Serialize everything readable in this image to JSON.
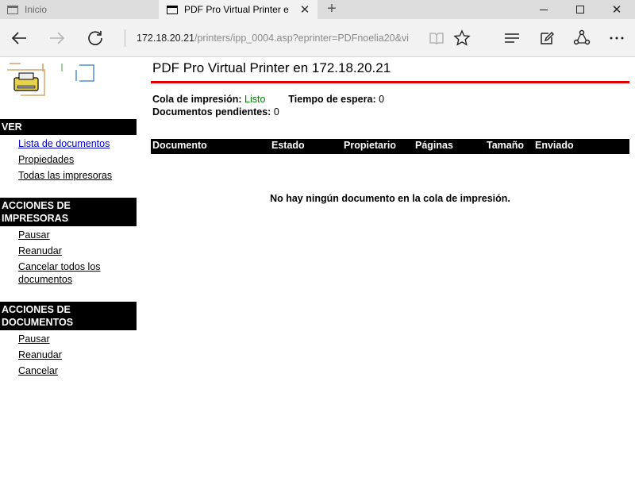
{
  "browser": {
    "tabs": [
      {
        "title": "Inicio"
      },
      {
        "title": "PDF Pro Virtual Printer e"
      }
    ],
    "url_host": "172.18.20.21",
    "url_rest": "/printers/ipp_0004.asp?eprinter=PDFnoelia20&vi"
  },
  "page": {
    "title": "PDF Pro Virtual Printer en 172.18.20.21",
    "queue_label": "Cola de impresión:",
    "queue_value": "Listo",
    "wait_label": "Tiempo de espera:",
    "wait_value": "0",
    "pending_label": "Documentos pendientes:",
    "pending_value": "0",
    "columns": [
      "Documento",
      "Estado",
      "Propietario",
      "Páginas",
      "Tamaño",
      "Enviado"
    ],
    "empty_message": "No hay ningún documento en la cola de impresión."
  },
  "sidebar": {
    "sections": [
      {
        "heading": "VER",
        "links": [
          "Lista de documentos",
          "Propiedades",
          "Todas las impresoras"
        ]
      },
      {
        "heading": "ACCIONES DE IMPRESORAS",
        "links": [
          "Pausar",
          "Reanudar",
          "Cancelar todos los documentos"
        ]
      },
      {
        "heading": "ACCIONES DE DOCUMENTOS",
        "links": [
          "Pausar",
          "Reanudar",
          "Cancelar"
        ]
      }
    ]
  },
  "colors": {
    "accent_line": "#e00000",
    "status_ok": "#008000",
    "link_active": "#0000cc"
  },
  "icons": [
    "tab-page-icon",
    "close-icon",
    "new-tab-icon",
    "minimize-icon",
    "maximize-icon",
    "window-close-icon",
    "back-icon",
    "forward-icon",
    "refresh-icon",
    "reading-view-icon",
    "favorite-star-icon",
    "hub-icon",
    "web-note-icon",
    "share-icon",
    "more-icon",
    "printer-icon"
  ]
}
